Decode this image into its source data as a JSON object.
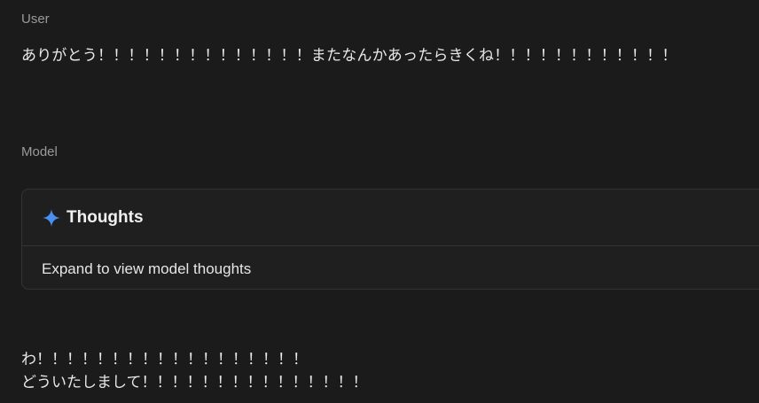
{
  "conversation": {
    "user": {
      "role_label": "User",
      "message": "ありがとう！！！！！！！！！！！！！！またなんかあったらきくね！！！！！！！！！！！！"
    },
    "model": {
      "role_label": "Model",
      "thoughts": {
        "icon": "sparkle-icon",
        "title": "Thoughts",
        "expand_label": "Expand to view model thoughts"
      },
      "response_lines": [
        "わ！！！！！！！！！！！！！！！！！！",
        "どういたしまして！！！！！！！！！！！！！！！"
      ]
    }
  },
  "colors": {
    "background": "#1b1b1b",
    "panel_border": "#333333",
    "sparkle_blue": "#4a90f0"
  }
}
